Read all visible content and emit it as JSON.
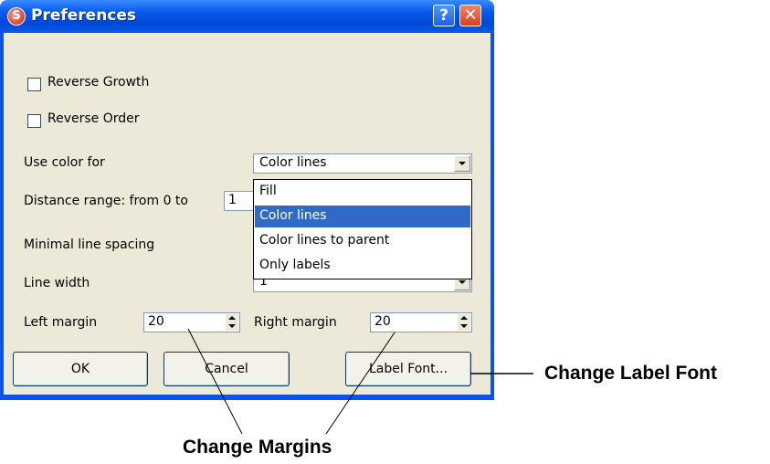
{
  "window": {
    "title": "Preferences",
    "app_icon": "app-logo-icon",
    "help_label": "?",
    "close_label": "✕"
  },
  "options": {
    "reverse_growth": {
      "label": "Reverse Growth",
      "checked": false
    },
    "reverse_order": {
      "label": "Reverse Order",
      "checked": false
    }
  },
  "fields": {
    "use_color_for_label": "Use color for",
    "use_color_for_value": "Color lines",
    "distance_range_label": "Distance range: from 0 to",
    "distance_range_value": "1",
    "min_line_spacing_label": "Minimal line spacing",
    "line_width_label": "Line width",
    "line_width_value": "1",
    "left_margin_label": "Left margin",
    "left_margin_value": "20",
    "right_margin_label": "Right margin",
    "right_margin_value": "20"
  },
  "dropdown": {
    "options": [
      "Fill",
      "Color lines",
      "Color lines to parent",
      "Only labels"
    ],
    "selected": "Color lines"
  },
  "buttons": {
    "ok": "OK",
    "cancel": "Cancel",
    "label_font": "Label Font..."
  },
  "annotations": {
    "change_label_font": "Change Label Font",
    "change_margins": "Change Margins"
  }
}
